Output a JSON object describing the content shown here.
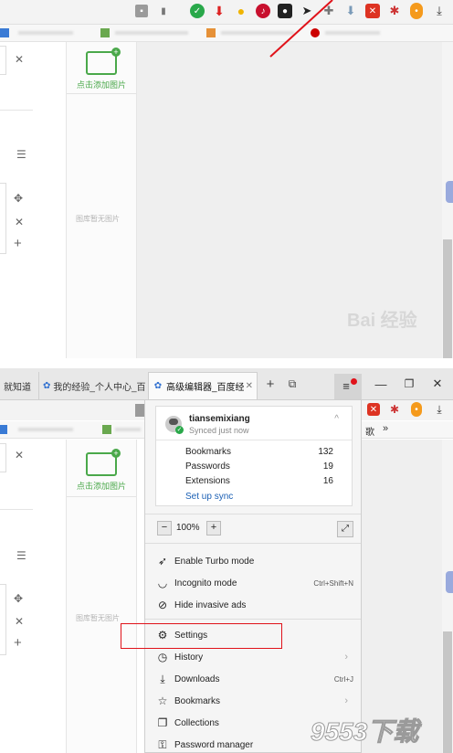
{
  "top": {
    "toolbar_icons": [
      "lock-icon",
      "bookmark-icon",
      "shield-icon",
      "download-icon",
      "lightbulb-icon",
      "music-icon",
      "mask-icon",
      "cursor-icon",
      "puzzle-icon",
      "down-arrow-icon",
      "adblock-icon",
      "bug-icon",
      "timer-icon",
      "save-icon"
    ],
    "sidebar": {
      "add_image": "点击添加图片",
      "empty_text": "图库暂无图片"
    },
    "watermark": "Bai 经验"
  },
  "bottom": {
    "tabs": [
      {
        "label": "就知道"
      },
      {
        "label": "我的经验_个人中心_百"
      },
      {
        "label": "高级编辑器_百度经"
      }
    ],
    "menu": {
      "user": {
        "name": "tiansemixiang",
        "status": "Synced just now"
      },
      "sync_rows": [
        {
          "label": "Bookmarks",
          "count": "132"
        },
        {
          "label": "Passwords",
          "count": "19"
        },
        {
          "label": "Extensions",
          "count": "16"
        }
      ],
      "setup_sync": "Set up sync",
      "zoom": {
        "minus": "−",
        "level": "100%",
        "plus": "+"
      },
      "items": [
        {
          "label": "Enable Turbo mode",
          "shortcut": ""
        },
        {
          "label": "Incognito mode",
          "shortcut": "Ctrl+Shift+N"
        },
        {
          "label": "Hide invasive ads",
          "shortcut": ""
        },
        {
          "label": "Settings",
          "shortcut": ""
        },
        {
          "label": "History",
          "shortcut": ""
        },
        {
          "label": "Downloads",
          "shortcut": "Ctrl+J"
        },
        {
          "label": "Bookmarks",
          "shortcut": ""
        },
        {
          "label": "Collections",
          "shortcut": ""
        },
        {
          "label": "Password manager",
          "shortcut": ""
        }
      ]
    },
    "right_text": {
      "kuan": "歌",
      "more": "»"
    },
    "sidebar": {
      "add_image": "点击添加图片",
      "empty_text": "图库暂无图片"
    },
    "watermark": "9553下载"
  },
  "colors": {
    "accent_red": "#e0121a",
    "green": "#4aa84a",
    "link_blue": "#1a5fb4"
  }
}
